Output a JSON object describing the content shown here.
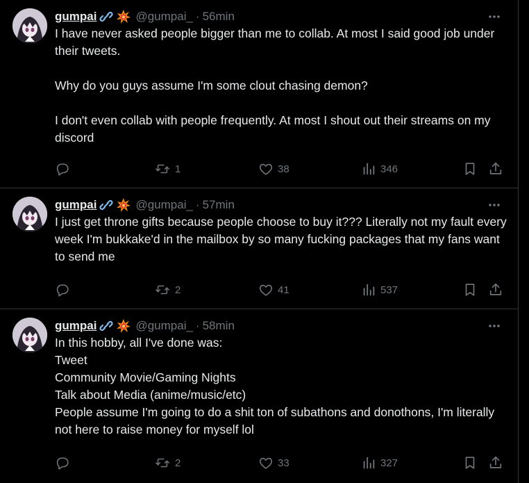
{
  "accent_colors": {
    "text": "#e7e9ea",
    "muted": "#71767b",
    "border": "#2f3336",
    "background": "#000000"
  },
  "tweets": [
    {
      "display_name": "gumpai",
      "badges": [
        "link-icon",
        "collision-icon"
      ],
      "handle": "@gumpai_",
      "separator": "·",
      "time": "56min",
      "text": "I have never asked people bigger than me to collab. At most I said good job under their tweets.\n\nWhy do you guys assume I'm some clout chasing demon?\n\nI don't even collab with people frequently. At most I shout out their streams on my discord",
      "replies": "",
      "retweets": "1",
      "likes": "38",
      "views": "346"
    },
    {
      "display_name": "gumpai",
      "badges": [
        "link-icon",
        "collision-icon"
      ],
      "handle": "@gumpai_",
      "separator": "·",
      "time": "57min",
      "text": "I just get throne gifts because people choose to buy it??? Literally not my fault every week I'm bukkake'd in the mailbox by so many fucking packages that my fans want to send me",
      "replies": "",
      "retweets": "2",
      "likes": "41",
      "views": "537"
    },
    {
      "display_name": "gumpai",
      "badges": [
        "link-icon",
        "collision-icon"
      ],
      "handle": "@gumpai_",
      "separator": "·",
      "time": "58min",
      "text": "In this hobby, all I've done was:\nTweet\nCommunity Movie/Gaming Nights\nTalk about Media (anime/music/etc)\nPeople assume I'm going to do a shit ton of subathons and donothons, I'm literally not here to raise money for myself lol",
      "replies": "",
      "retweets": "2",
      "likes": "33",
      "views": "327"
    }
  ]
}
